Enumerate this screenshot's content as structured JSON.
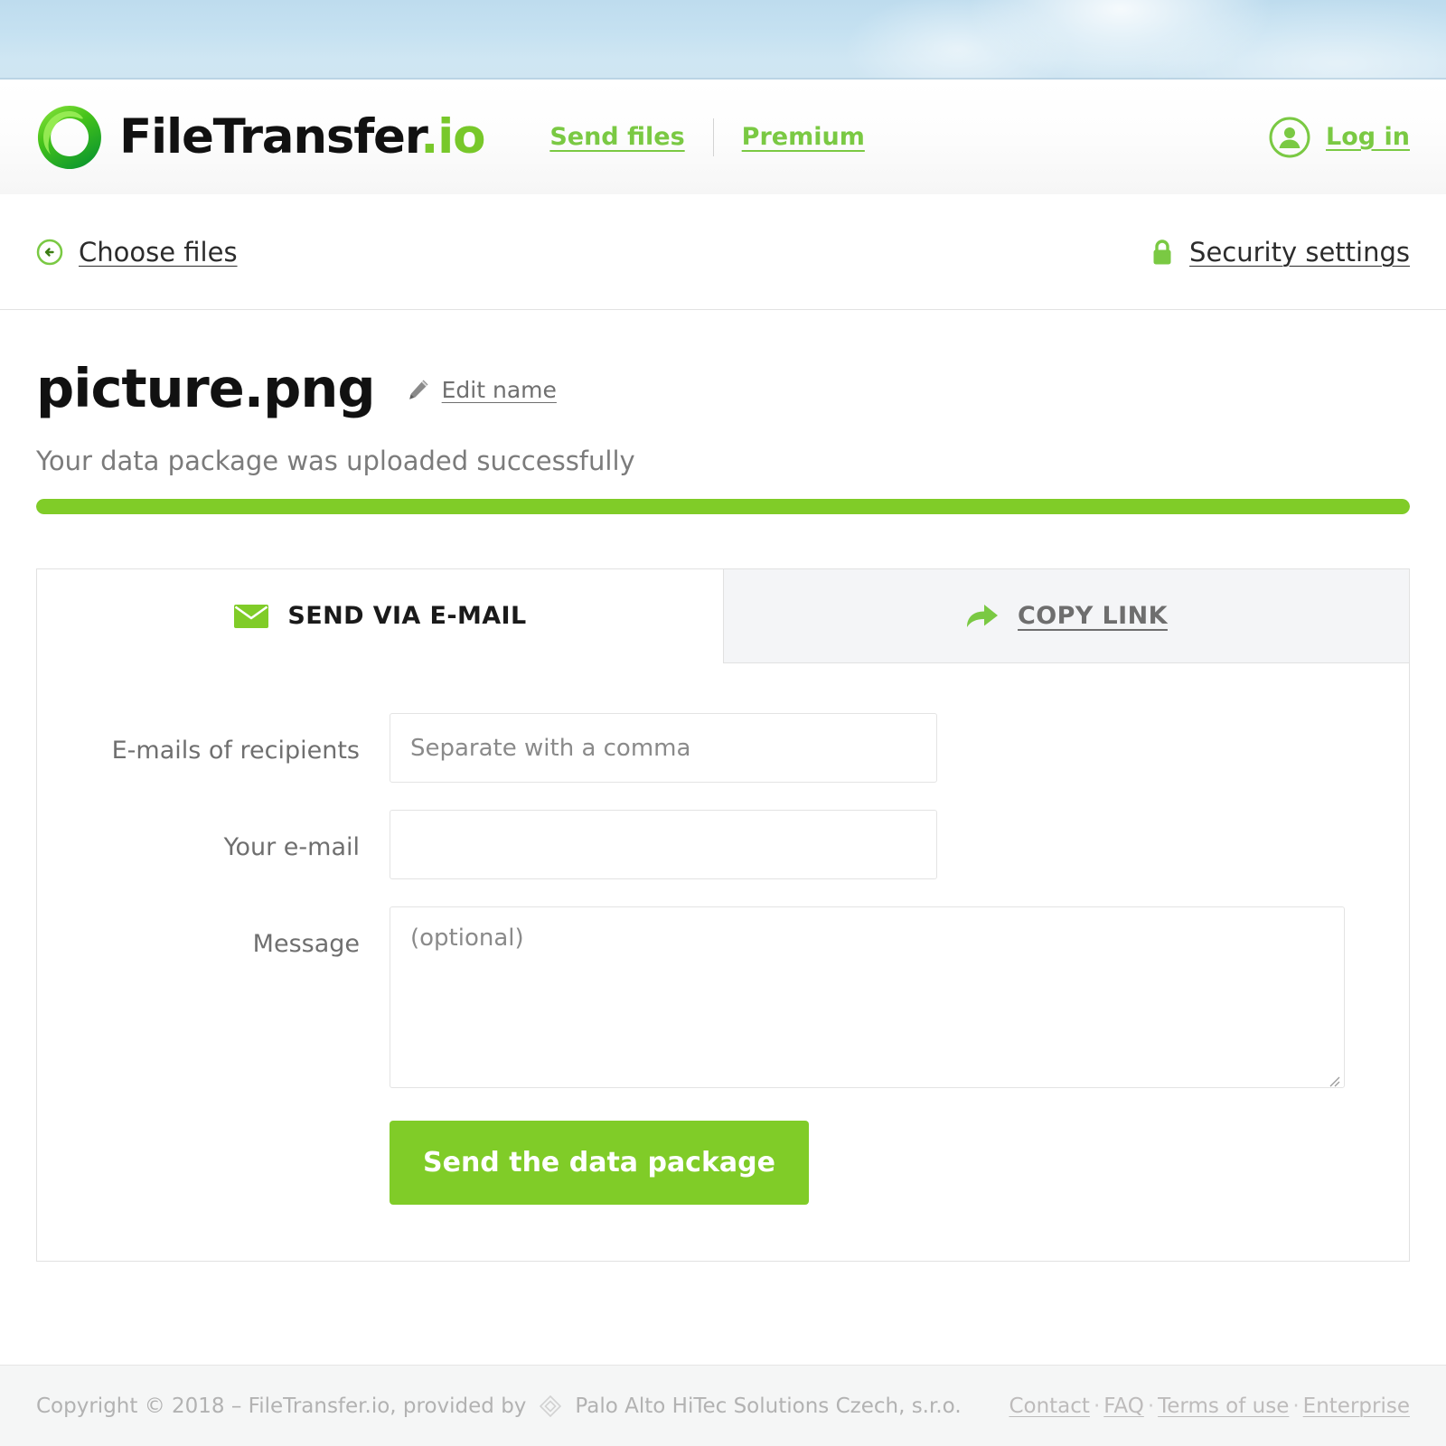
{
  "header": {
    "brand_name": "FileTransfer",
    "brand_suffix": ".io",
    "logo_icon": "filetransfer-ring-logo",
    "nav": [
      {
        "label": "Send files",
        "icon": ""
      },
      {
        "label": "Premium",
        "icon": ""
      }
    ],
    "login": {
      "label": "Log in",
      "icon": "user-circle-icon"
    }
  },
  "subheader": {
    "choose_files": {
      "label": "Choose files",
      "icon": "circle-back-arrow-icon"
    },
    "security_settings": {
      "label": "Security settings",
      "icon": "lock-icon"
    }
  },
  "main": {
    "file_name": "picture.png",
    "edit_name": {
      "label": "Edit name",
      "icon": "pencil-icon"
    },
    "status_text": "Your data package was uploaded successfully",
    "progress": {
      "percent": 100,
      "fill_color": "#80cc28",
      "track_color": "#e8e8e8"
    },
    "tabs": [
      {
        "label": "SEND VIA E-MAIL",
        "icon": "envelope-icon",
        "active": true
      },
      {
        "label": "COPY LINK",
        "icon": "share-arrow-icon",
        "active": false
      }
    ],
    "form": {
      "recipients": {
        "label": "E-mails of recipients",
        "placeholder": "Separate with a comma",
        "value": ""
      },
      "your_email": {
        "label": "Your e-mail",
        "placeholder": "",
        "value": ""
      },
      "message": {
        "label": "Message",
        "placeholder": "(optional)",
        "value": ""
      },
      "submit_label": "Send the data package"
    }
  },
  "footer": {
    "copyright": "Copyright © 2018 – FileTransfer.io, provided by",
    "partner_icon": "diamond-logo-icon",
    "partner": "Palo Alto HiTec Solutions Czech, s.r.o.",
    "links": [
      "Contact",
      "FAQ",
      "Terms of use",
      "Enterprise"
    ],
    "separator": "·"
  },
  "colors": {
    "brand_green": "#7ac943",
    "progress_green": "#80cc28",
    "sky_blue": "#c5e1f1",
    "text_dark": "#111111",
    "text_muted": "#6f6f6f"
  }
}
